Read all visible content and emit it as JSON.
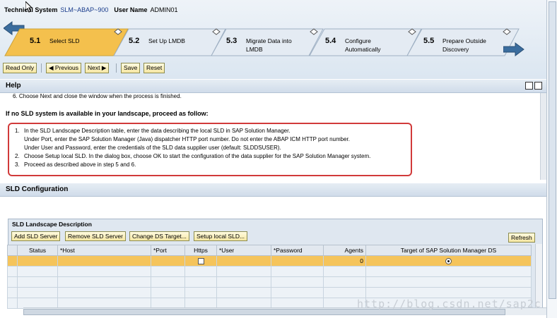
{
  "header": {
    "system_label": "Technical System",
    "system_value": "SLM~ABAP~900",
    "user_label": "User Name",
    "user_value": "ADMIN01"
  },
  "steps": [
    {
      "num": "5.1",
      "label": "Select SLD",
      "active": true
    },
    {
      "num": "5.2",
      "label": "Set Up LMDB",
      "active": false
    },
    {
      "num": "5.3",
      "label": "Migrate Data into LMDB",
      "active": false
    },
    {
      "num": "5.4",
      "label": "Configure Automatically",
      "active": false
    },
    {
      "num": "5.5",
      "label": "Prepare Outside Discovery",
      "active": false
    }
  ],
  "toolbar": {
    "read_only": "Read Only",
    "previous": "Previous",
    "next": "Next",
    "save": "Save",
    "reset": "Reset"
  },
  "help": {
    "title": "Help",
    "cut_line": "6.   Choose Next and close the window when the process is finished.",
    "no_sld_heading": "If no SLD system is available in your landscape, proceed as follow:",
    "items": [
      {
        "n": "1.",
        "t": "In the SLD Landscape Description table, enter the data describing the local SLD in SAP Solution Manager."
      },
      {
        "n": "",
        "t": "Under Port, enter the SAP Solution Manager (Java) dispatcher HTTP port number. Do not enter the ABAP ICM HTTP port number."
      },
      {
        "n": "",
        "t": "Under User and Password, enter the credentials of the SLD data supplier user (default: SLDDSUSER)."
      },
      {
        "n": "2.",
        "t": "Choose Setup local SLD. In the dialog box, choose OK to start the configuration of the data supplier for the SAP Solution Manager system."
      },
      {
        "n": "3.",
        "t": "Proceed as described above in step 5 and 6."
      }
    ]
  },
  "sld_config": {
    "title": "SLD Configuration",
    "panel_title": "SLD Landscape Description",
    "buttons": [
      "Add SLD Server",
      "Remove SLD Server",
      "Change DS Target...",
      "Setup local SLD..."
    ],
    "refresh": "Refresh",
    "columns": [
      "",
      "Status",
      "*Host",
      "*Port",
      "Https",
      "*User",
      "*Password",
      "Agents",
      "Target of SAP Solution Manager DS"
    ],
    "row_agents": "0"
  },
  "watermark": "http://blog.csdn.net/sap2c"
}
